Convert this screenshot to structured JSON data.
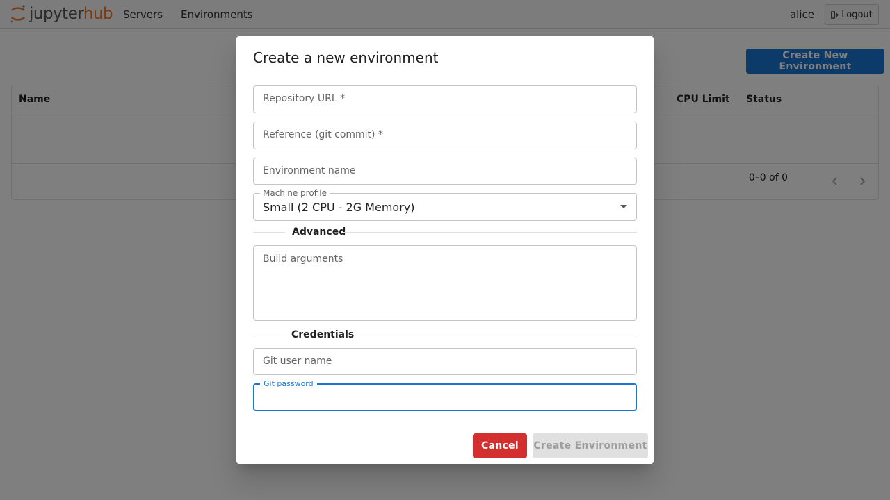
{
  "navbar": {
    "logo": {
      "part1": "jupyter",
      "part2": "hub"
    },
    "links": [
      "Servers",
      "Environments"
    ],
    "user": "alice",
    "logout_label": "Logout"
  },
  "page": {
    "create_button": "Create New Environment",
    "table": {
      "headers": {
        "name": "Name",
        "cpu_limit": "CPU Limit",
        "status": "Status"
      },
      "pagination": "0–0 of 0"
    }
  },
  "dialog": {
    "title": "Create a new environment",
    "fields": {
      "repo_url": "Repository URL *",
      "reference": "Reference (git commit) *",
      "env_name": "Environment name",
      "machine_profile_label": "Machine profile",
      "machine_profile_value": "Small (2 CPU - 2G Memory)",
      "build_args": "Build arguments",
      "git_user": "Git user name",
      "git_password_label": "Git password"
    },
    "sections": {
      "advanced": "Advanced",
      "credentials": "Credentials"
    },
    "buttons": {
      "cancel": "Cancel",
      "create": "Create Environment"
    }
  },
  "colors": {
    "primary": "#1976d2",
    "danger": "#d32f2f",
    "brand": "#f37726"
  }
}
